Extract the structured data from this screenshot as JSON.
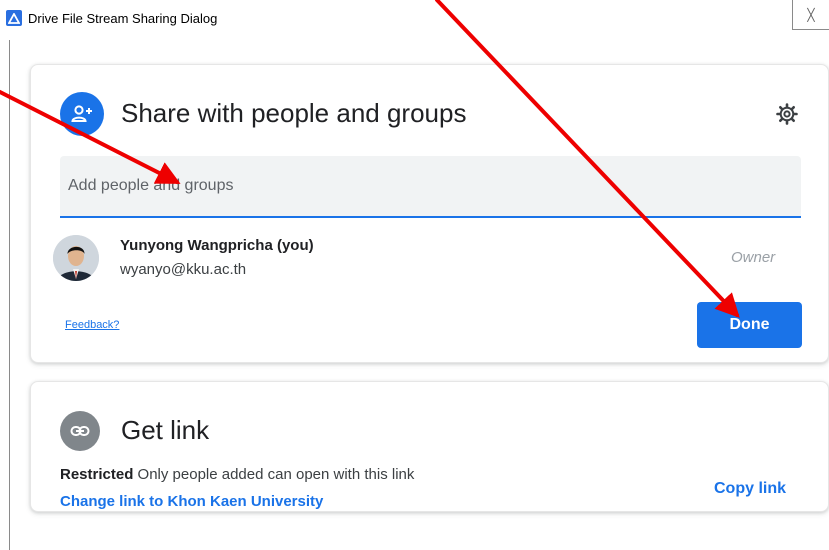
{
  "window": {
    "title": "Drive File Stream Sharing Dialog",
    "close_label": "╳"
  },
  "share": {
    "title": "Share with people and groups",
    "input_placeholder": "Add people and groups",
    "input_value": "",
    "user": {
      "name": "Yunyong Wangpricha (you)",
      "email": "wyanyo@kku.ac.th",
      "role": "Owner"
    },
    "feedback_label": "Feedback?",
    "done_label": "Done"
  },
  "link": {
    "title": "Get link",
    "restricted_label": "Restricted",
    "restricted_desc": "Only people added can open with this link",
    "change_label": "Change link to Khon Kaen University",
    "copy_label": "Copy link"
  },
  "icons": {
    "app": "drive-icon",
    "share_header": "person-add-icon",
    "settings": "gear-icon",
    "link": "link-icon"
  },
  "colors": {
    "accent": "#1a73e8",
    "annotation_arrow": "#ee0000",
    "link_icon_bg": "#80868b"
  }
}
